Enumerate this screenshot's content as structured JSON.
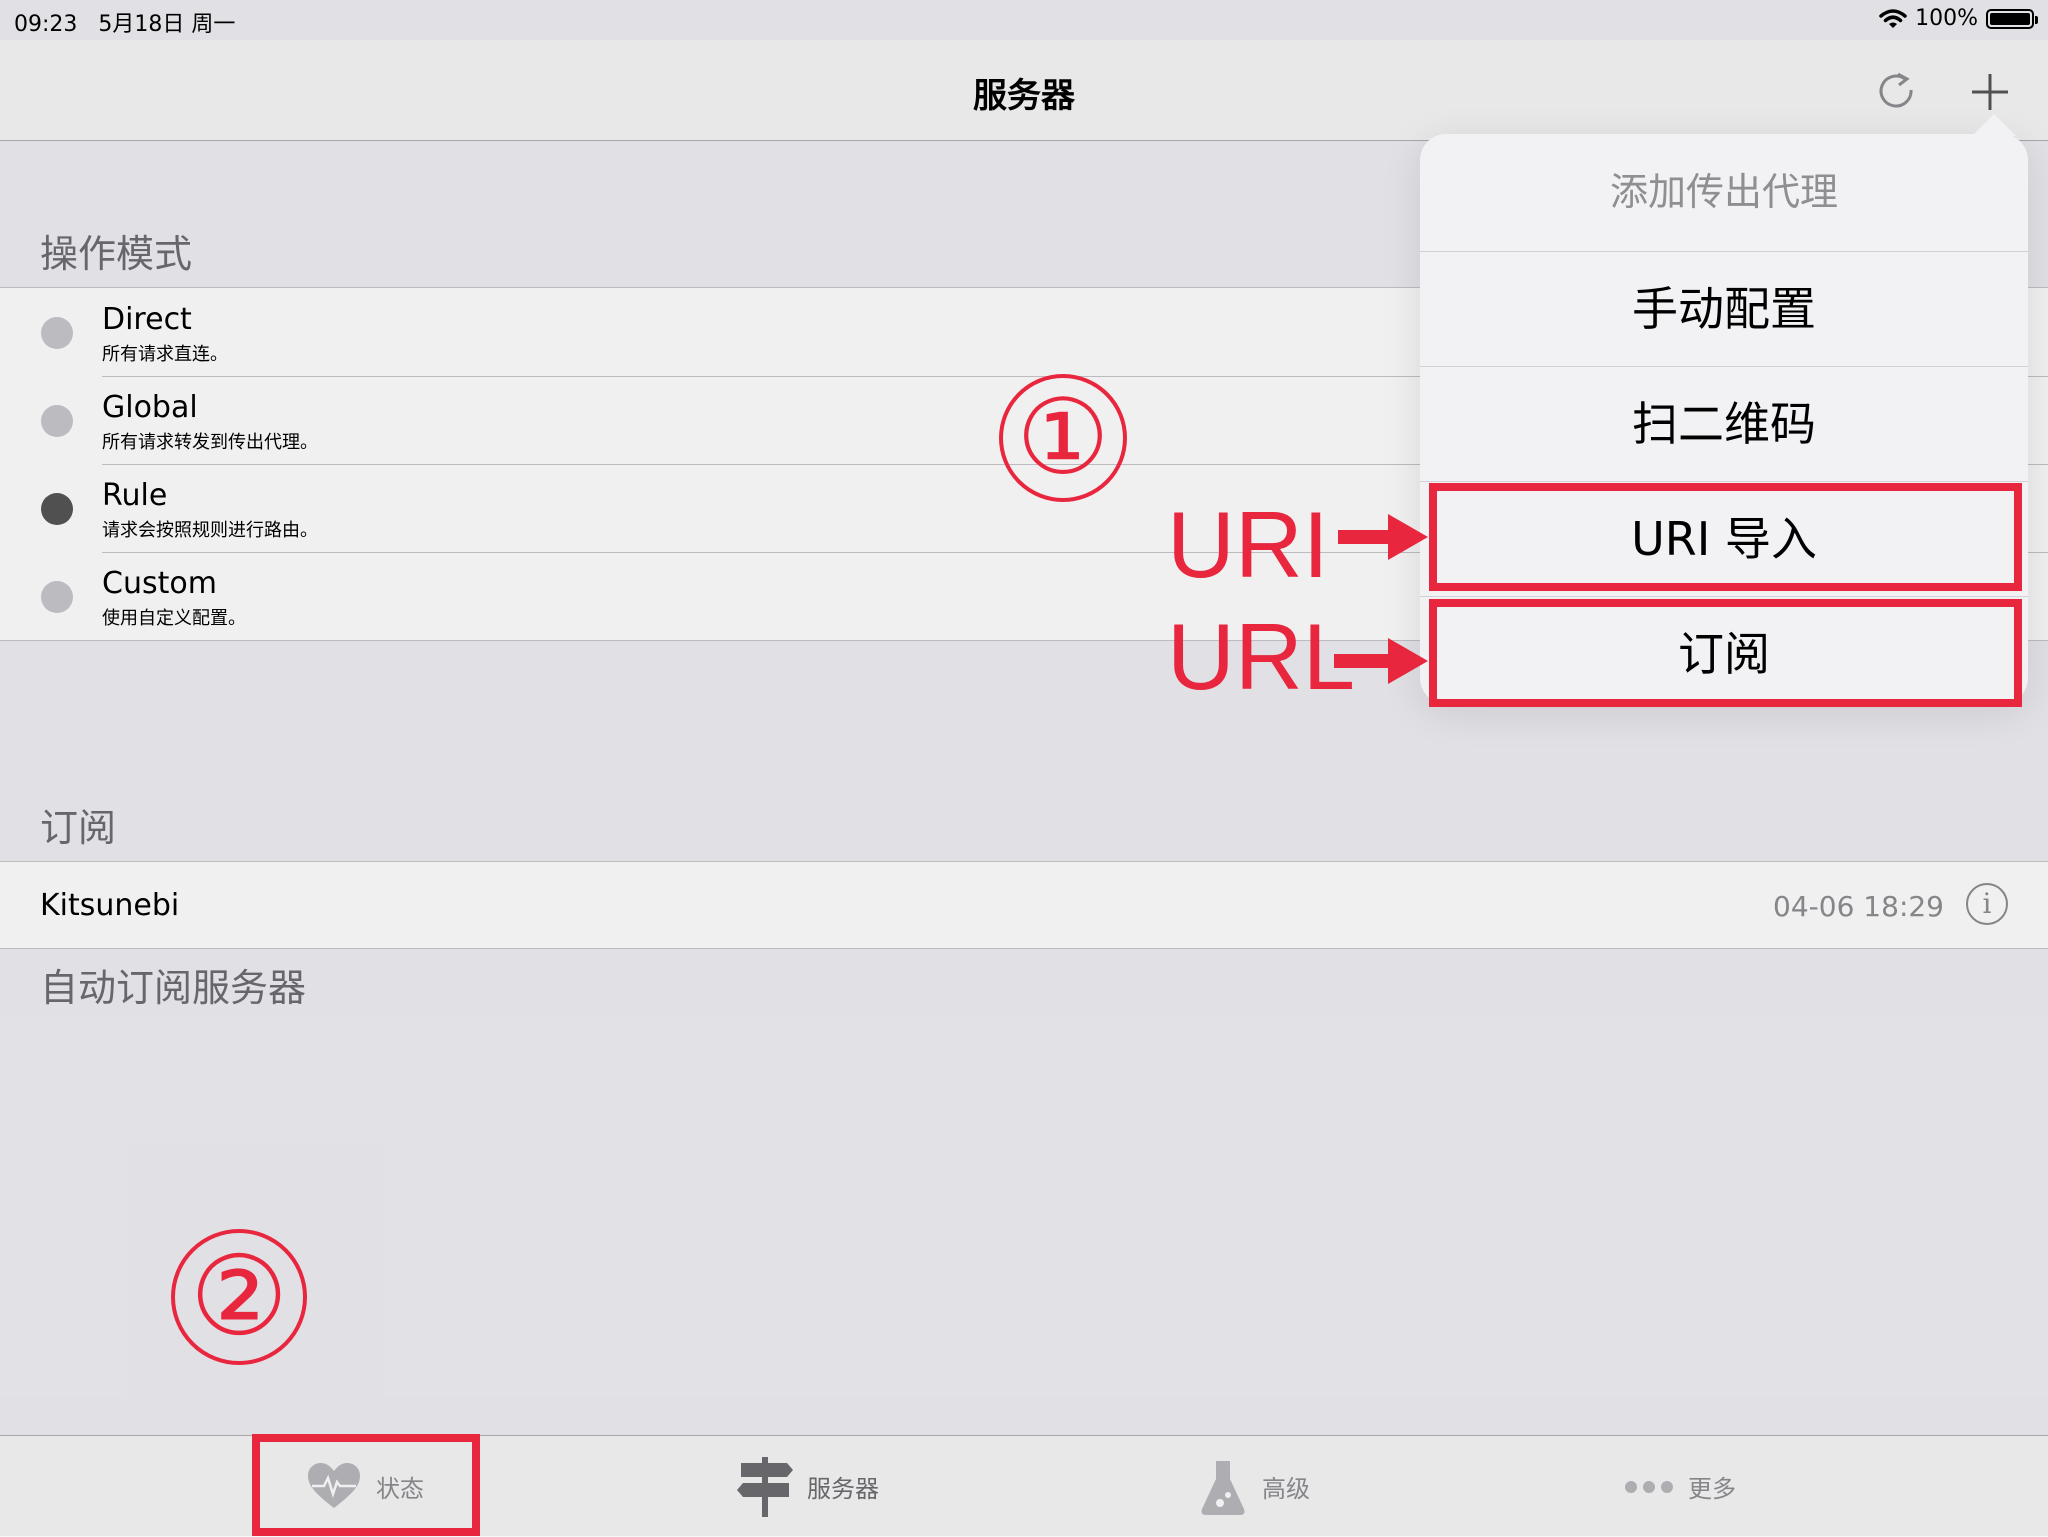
{
  "status_bar": {
    "time": "09:23",
    "date": "5月18日 周一",
    "battery": "100%",
    "battery_fill": 1.0
  },
  "nav": {
    "title": "服务器",
    "refresh_icon": "refresh-icon",
    "add_icon": "plus-icon"
  },
  "mode_section": {
    "header": "操作模式",
    "items": [
      {
        "title": "Direct",
        "subtitle": "所有请求直连。",
        "selected": false
      },
      {
        "title": "Global",
        "subtitle": "所有请求转发到传出代理。",
        "selected": false
      },
      {
        "title": "Rule",
        "subtitle": "请求会按照规则进行路由。",
        "selected": true
      },
      {
        "title": "Custom",
        "subtitle": "使用自定义配置。",
        "selected": false
      }
    ]
  },
  "subscription_section": {
    "header": "订阅",
    "items": [
      {
        "name": "Kitsunebi",
        "time": "04-06 18:29",
        "icon": "info-icon"
      }
    ],
    "footer": "自动订阅服务器"
  },
  "popover": {
    "title": "添加传出代理",
    "items": [
      "手动配置",
      "扫二维码",
      "URI 导入",
      "订阅"
    ]
  },
  "annotations": {
    "circle1": "①",
    "circle2": "②",
    "uri_label": "URI",
    "url_label": "URL"
  },
  "tabs": [
    {
      "label": "状态",
      "icon": "heart-pulse-icon"
    },
    {
      "label": "服务器",
      "icon": "signpost-icon"
    },
    {
      "label": "高级",
      "icon": "flask-icon"
    },
    {
      "label": "更多",
      "icon": "more-dots-icon"
    }
  ],
  "colors": {
    "annotation_red": "#e8273f",
    "background": "#efeff4",
    "selected_radio": "#555555"
  }
}
